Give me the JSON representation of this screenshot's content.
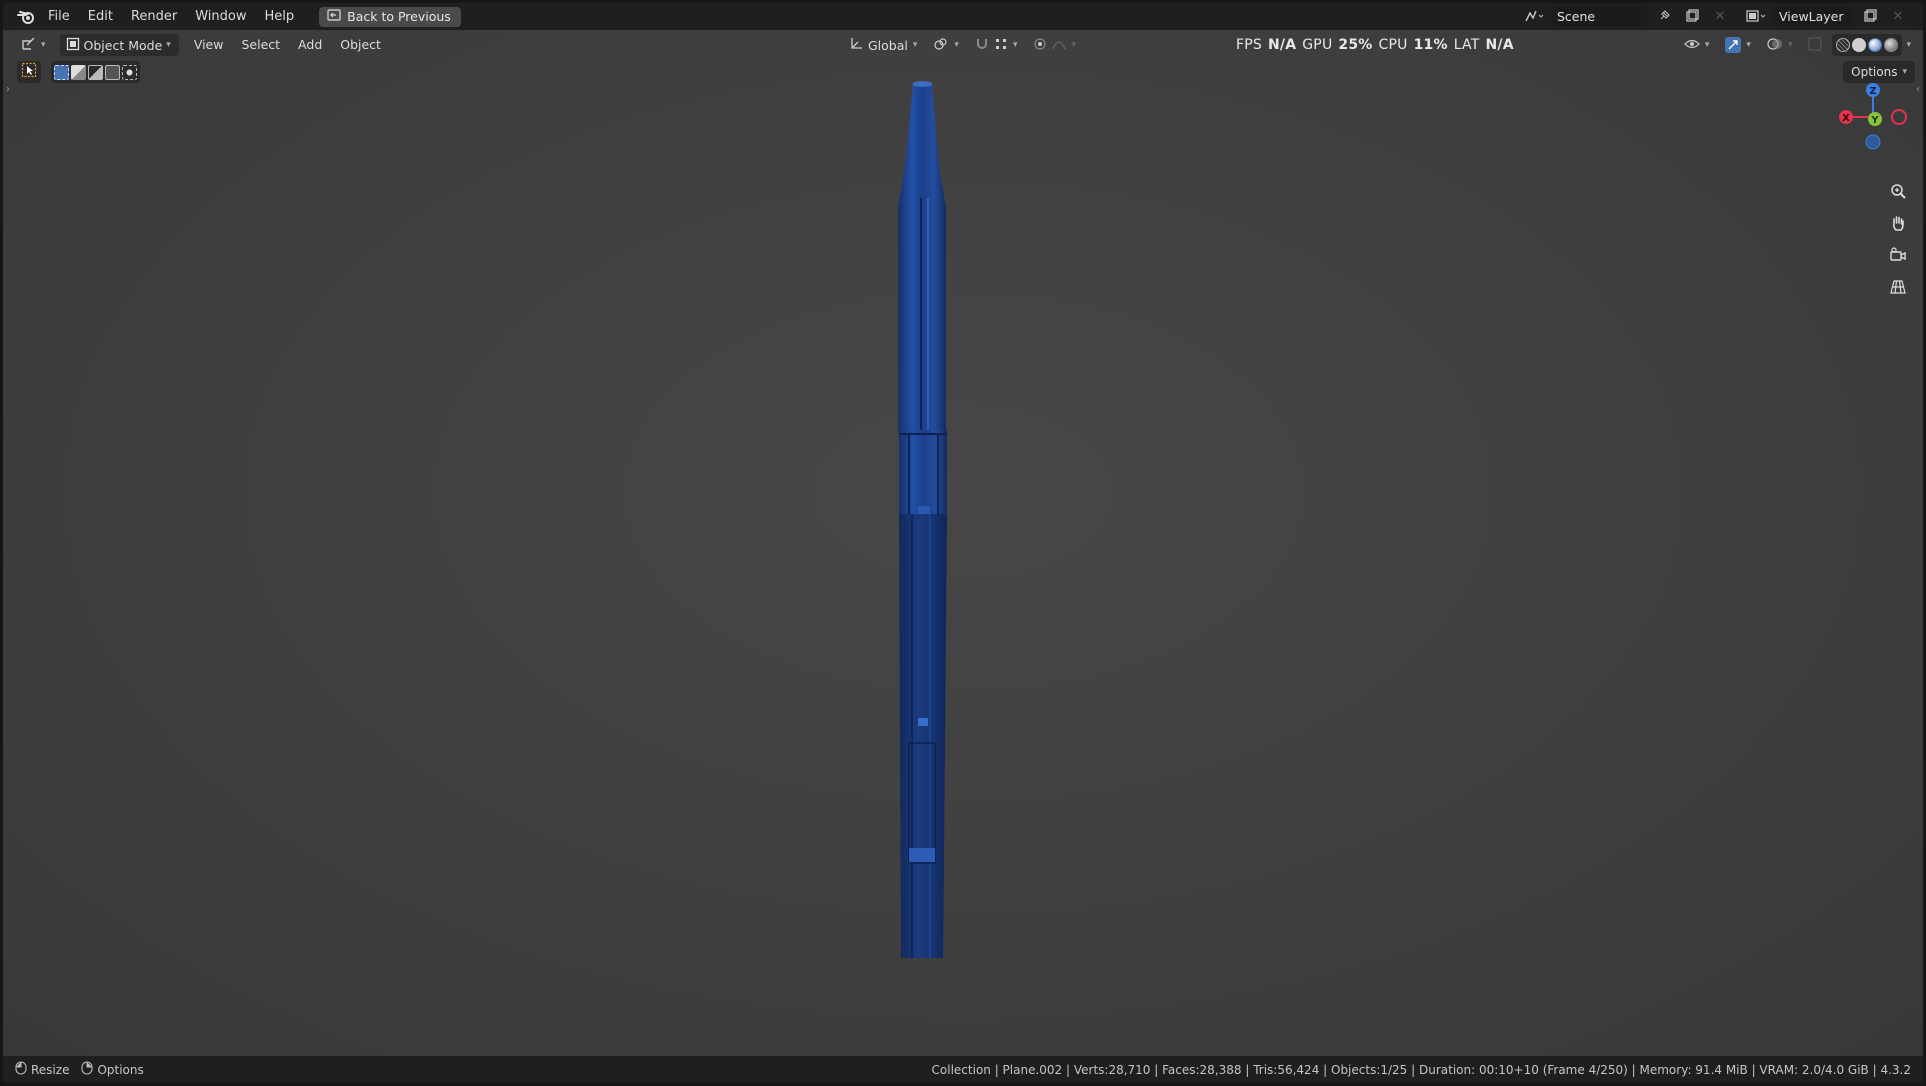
{
  "menubar": {
    "items": [
      "File",
      "Edit",
      "Render",
      "Window",
      "Help"
    ],
    "back_button": "Back to Previous",
    "scene_label": "Scene",
    "viewlayer_label": "ViewLayer"
  },
  "viewport_header": {
    "mode": "Object Mode",
    "menus": [
      "View",
      "Select",
      "Add",
      "Object"
    ],
    "transform_orientation": "Global",
    "options_label": "Options"
  },
  "perf": {
    "fps_label": "FPS",
    "fps_value": "N/A",
    "gpu_label": "GPU",
    "gpu_value": "25%",
    "cpu_label": "CPU",
    "cpu_value": "11%",
    "lat_label": "LAT",
    "lat_value": "N/A"
  },
  "gizmo": {
    "z": "Z",
    "y": "Y",
    "x": "X",
    "colors": {
      "x": "#e2344f",
      "y": "#86c23b",
      "z": "#3a80e6"
    }
  },
  "statusbar": {
    "left": [
      {
        "icon": "mouse-left-icon",
        "label": "Resize"
      },
      {
        "icon": "mouse-right-icon",
        "label": "Options"
      }
    ],
    "info": "Collection | Plane.002 | Verts:28,710 | Faces:28,388 | Tris:56,424 | Objects:1/25 | Duration: 00:10+10 (Frame 4/250) | Memory: 91.4 MiB | VRAM: 2.0/4.0 GiB | 4.3.2"
  },
  "colors": {
    "object_blue": "#1c3a7a",
    "viewport_bg": "#3f3f3f",
    "accent": "#4772b3"
  }
}
